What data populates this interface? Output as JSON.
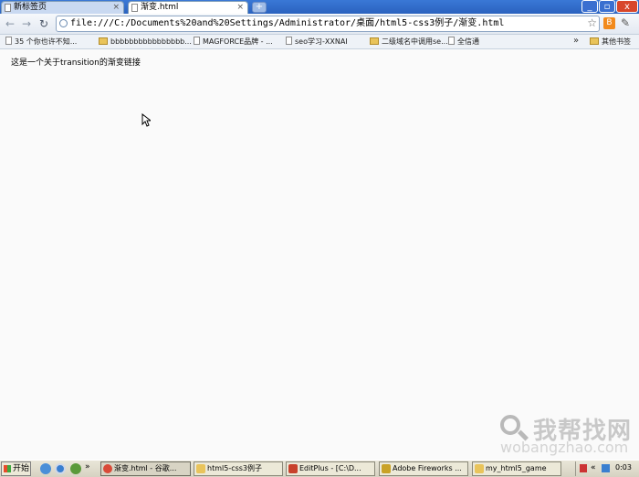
{
  "browser": {
    "tabs": [
      {
        "title": "新标签页",
        "active": false
      },
      {
        "title": "渐变.html",
        "active": true
      }
    ],
    "new_tab_symbol": "+",
    "window_buttons": [
      "_",
      "▫",
      "x"
    ],
    "url": "file:///C:/Documents%20and%20Settings/Administrator/桌面/html5-css3例子/渐变.html"
  },
  "bookmarks": {
    "items": [
      {
        "label": "35 个你也许不知...",
        "icon": "page-icon"
      },
      {
        "label": "bbbbbbbbbbbbbbbb...",
        "icon": "folder-icon"
      },
      {
        "label": "MAGFORCE品牌 - ...",
        "icon": "page-icon"
      },
      {
        "label": "seo学习-XXNAI",
        "icon": "page-icon"
      },
      {
        "label": "二级域名中调用se...",
        "icon": "folder-icon"
      },
      {
        "label": "全信通",
        "icon": "page-icon"
      }
    ],
    "more": "»",
    "other_folder": "其他书签"
  },
  "page": {
    "link_text": "这是一个关于transition的渐变链接"
  },
  "watermark": {
    "title": "我帮找网",
    "url": "wobangzhao.com"
  },
  "taskbar": {
    "start_label": "开始",
    "more": "»",
    "tasks": [
      {
        "label": "渐变.html - 谷歌...",
        "color": "#d94a38",
        "active": true
      },
      {
        "label": "html5-css3例子",
        "color": "#e9c45b",
        "active": false
      },
      {
        "label": "EditPlus - [C:\\D...",
        "color": "#c8412c",
        "active": false
      },
      {
        "label": "Adobe Fireworks ...",
        "color": "#c9a227",
        "active": false
      },
      {
        "label": "my_html5_game",
        "color": "#e9c45b",
        "active": false
      }
    ],
    "clock": "0:03"
  },
  "colors": {
    "titlebar": "#2a62bf",
    "content_bg": "#fafafa",
    "taskbar": "#d6d2c2"
  }
}
